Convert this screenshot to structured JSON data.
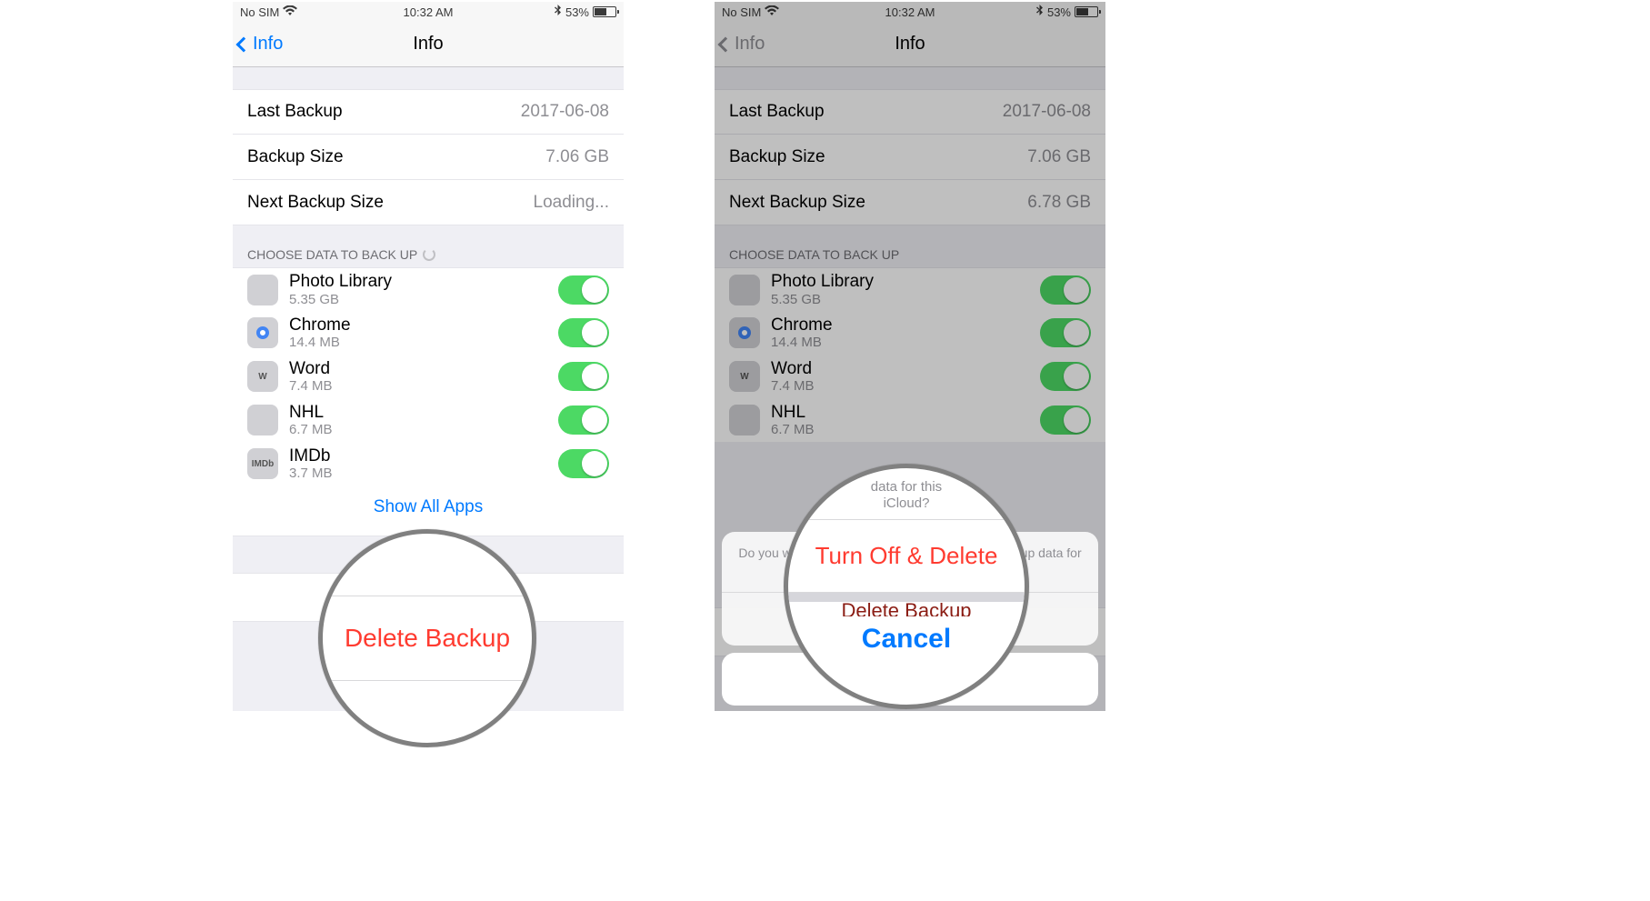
{
  "status": {
    "carrier": "No SIM",
    "time": "10:32 AM",
    "battery_pct": "53%"
  },
  "nav": {
    "back_label": "Info",
    "title": "Info"
  },
  "leftScreen": {
    "info": {
      "last_backup_label": "Last Backup",
      "last_backup_value": "2017-06-08",
      "backup_size_label": "Backup Size",
      "backup_size_value": "7.06 GB",
      "next_backup_label": "Next Backup Size",
      "next_backup_value": "Loading..."
    },
    "section_header": "CHOOSE DATA TO BACK UP",
    "apps": [
      {
        "name": "Photo Library",
        "size": "5.35 GB",
        "iconClass": "icon-photos",
        "iconText": ""
      },
      {
        "name": "Chrome",
        "size": "14.4 MB",
        "iconClass": "icon-chrome",
        "iconText": ""
      },
      {
        "name": "Word",
        "size": "7.4 MB",
        "iconClass": "icon-word",
        "iconText": "W"
      },
      {
        "name": "NHL",
        "size": "6.7 MB",
        "iconClass": "icon-nhl",
        "iconText": ""
      },
      {
        "name": "IMDb",
        "size": "3.7 MB",
        "iconClass": "icon-imdb",
        "iconText": "IMDb"
      }
    ],
    "show_all": "Show All Apps",
    "delete_backup": "Delete Backup"
  },
  "rightScreen": {
    "info": {
      "last_backup_label": "Last Backup",
      "last_backup_value": "2017-06-08",
      "backup_size_label": "Backup Size",
      "backup_size_value": "7.06 GB",
      "next_backup_label": "Next Backup Size",
      "next_backup_value": "6.78 GB"
    },
    "section_header": "CHOOSE DATA TO BACK UP",
    "apps": [
      {
        "name": "Photo Library",
        "size": "5.35 GB",
        "iconClass": "icon-photos",
        "iconText": ""
      },
      {
        "name": "Chrome",
        "size": "14.4 MB",
        "iconClass": "icon-chrome",
        "iconText": ""
      },
      {
        "name": "Word",
        "size": "7.4 MB",
        "iconClass": "icon-word",
        "iconText": "W"
      },
      {
        "name": "NHL",
        "size": "6.7 MB",
        "iconClass": "icon-nhl",
        "iconText": ""
      }
    ],
    "action_sheet": {
      "message": "Do you want to turn off backup and delete all backup data for this iPhone from iCloud?",
      "destructive": "Turn Off & Delete",
      "cancel": "Cancel"
    },
    "delete_backup": "Delete Backup"
  },
  "magnifiers": {
    "left": "Delete Backup",
    "right_top_a": "data for this",
    "right_top_b": "iCloud?",
    "right_mid": "Turn Off & Delete",
    "right_strike": "Delete Backup",
    "right_bottom": "Cancel"
  }
}
